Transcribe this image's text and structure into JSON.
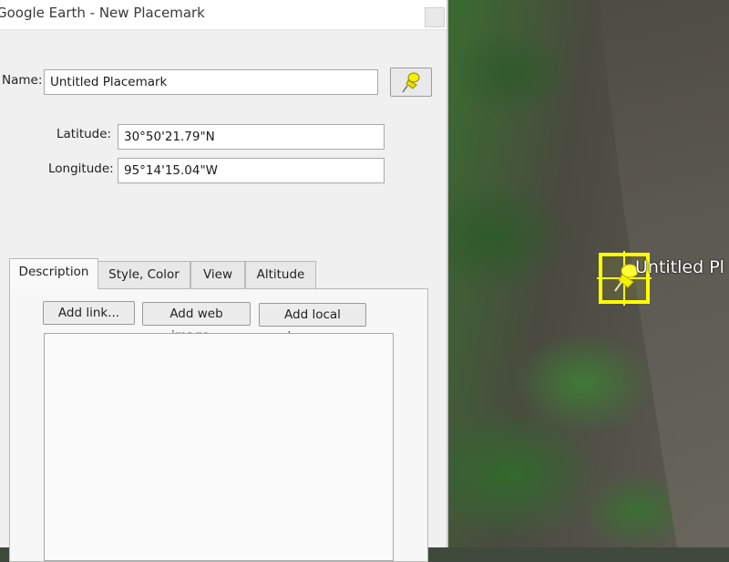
{
  "window": {
    "title": "Google Earth - New Placemark"
  },
  "form": {
    "name_label": "Name:",
    "name_value": "Untitled Placemark",
    "latitude_label": "Latitude:",
    "latitude_value": "30°50'21.79\"N",
    "longitude_label": "Longitude:",
    "longitude_value": "95°14'15.04\"W"
  },
  "tabs": [
    {
      "label": "Description",
      "active": true
    },
    {
      "label": "Style, Color",
      "active": false
    },
    {
      "label": "View",
      "active": false
    },
    {
      "label": "Altitude",
      "active": false
    }
  ],
  "description": {
    "add_link_label": "Add link...",
    "add_web_image_label": "Add web image...",
    "add_local_image_label": "Add local image..."
  },
  "map": {
    "placemark_label": "Untitled Pl",
    "marker_color": "#ffff00",
    "pin_icon": "yellow-pushpin-icon"
  },
  "colors": {
    "dialog_bg": "#f0f0f0",
    "marker": "#ffff00"
  }
}
